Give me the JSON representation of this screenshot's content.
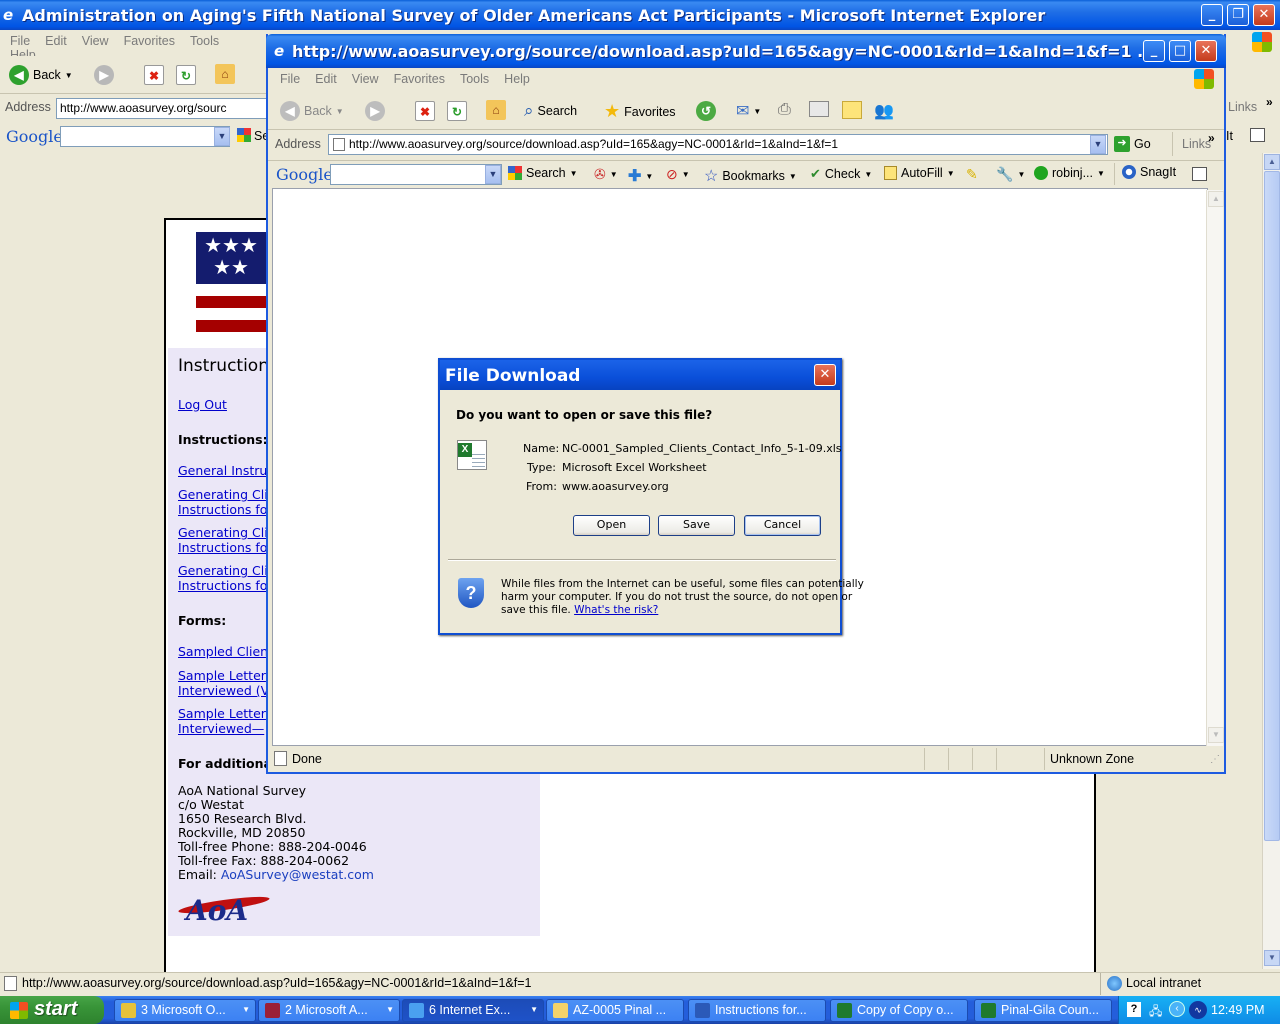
{
  "bg_window": {
    "title": "Administration on Aging's Fifth National Survey of Older Americans Act Participants - Microsoft Internet Explorer",
    "menu": [
      "File",
      "Edit",
      "View",
      "Favorites",
      "Tools",
      "Help"
    ],
    "back_label": "Back",
    "address_label": "Address",
    "address_value": "http://www.aoasurvey.org/sourc",
    "links_label": "Links",
    "google_label": "Google",
    "snagit_partial": "It",
    "status_url": "http://www.aoasurvey.org/source/download.asp?uId=165&agy=NC-0001&rId=1&aInd=1&f=1",
    "status_zone": "Local intranet"
  },
  "page": {
    "heading": "Instruction",
    "logout": "Log Out",
    "instructions_heading": "Instructions:",
    "instruction_links": [
      [
        "General Instru"
      ],
      [
        "Generating Cli",
        "Instructions fo"
      ],
      [
        "Generating Cli",
        "Instructions fo"
      ],
      [
        "Generating Cli",
        "Instructions fo"
      ]
    ],
    "forms_heading": "Forms:",
    "form_links": [
      [
        "Sampled Client"
      ],
      [
        "Sample Letter",
        "Interviewed (V"
      ],
      [
        "Sample Letter",
        "Interviewed—"
      ]
    ],
    "additional_heading": "For additional",
    "address_lines": [
      "AoA National Survey",
      "c/o Westat",
      "1650 Research Blvd.",
      "Rockville, MD 20850",
      "Toll-free Phone: 888-204-0046",
      "Toll-free Fax: 888-204-0062"
    ],
    "email_label": "Email: ",
    "email": "AoASurvey@westat.com",
    "logo_text": "AoA"
  },
  "fg_window": {
    "title": "http://www.aoasurvey.org/source/download.asp?uId=165&agy=NC-0001&rId=1&aInd=1&f=1 ...",
    "menu": [
      "File",
      "Edit",
      "View",
      "Favorites",
      "Tools",
      "Help"
    ],
    "back_label": "Back",
    "search_label": "Search",
    "favorites_label": "Favorites",
    "address_label": "Address",
    "address_value": "http://www.aoasurvey.org/source/download.asp?uId=165&agy=NC-0001&rId=1&aInd=1&f=1",
    "go_label": "Go",
    "links_label": "Links",
    "google_label": "Google",
    "gtb": {
      "search": "Search",
      "bookmarks": "Bookmarks",
      "check": "Check",
      "autofill": "AutoFill",
      "user": "robinj...",
      "snagit": "SnagIt"
    },
    "status_text": "Done",
    "zone_text": "Unknown Zone"
  },
  "dialog": {
    "title": "File Download",
    "question": "Do you want to open or save this file?",
    "name_label": "Name:",
    "name_value": "NC-0001_Sampled_Clients_Contact_Info_5-1-09.xls",
    "type_label": "Type:",
    "type_value": "Microsoft Excel Worksheet",
    "from_label": "From:",
    "from_value": "www.aoasurvey.org",
    "open_btn": "Open",
    "save_btn": "Save",
    "cancel_btn": "Cancel",
    "warning_1": "While files from the Internet can be useful, some files can potentially",
    "warning_2": "harm your computer. If you do not trust the source, do not open or",
    "warning_3": "save this file.",
    "risk_link": "What's the risk?"
  },
  "taskbar": {
    "start": "start",
    "tasks": [
      "3 Microsoft O...",
      "2 Microsoft A...",
      "6 Internet Ex...",
      "AZ-0005 Pinal ...",
      "Instructions for...",
      "Copy of Copy o...",
      "Pinal-Gila Coun..."
    ],
    "clock": "12:49 PM"
  },
  "colors": {
    "xp_blue": "#0055e5",
    "link": "#0000cc",
    "aoa_red": "#a50000",
    "aoa_navy": "#141c6e"
  }
}
